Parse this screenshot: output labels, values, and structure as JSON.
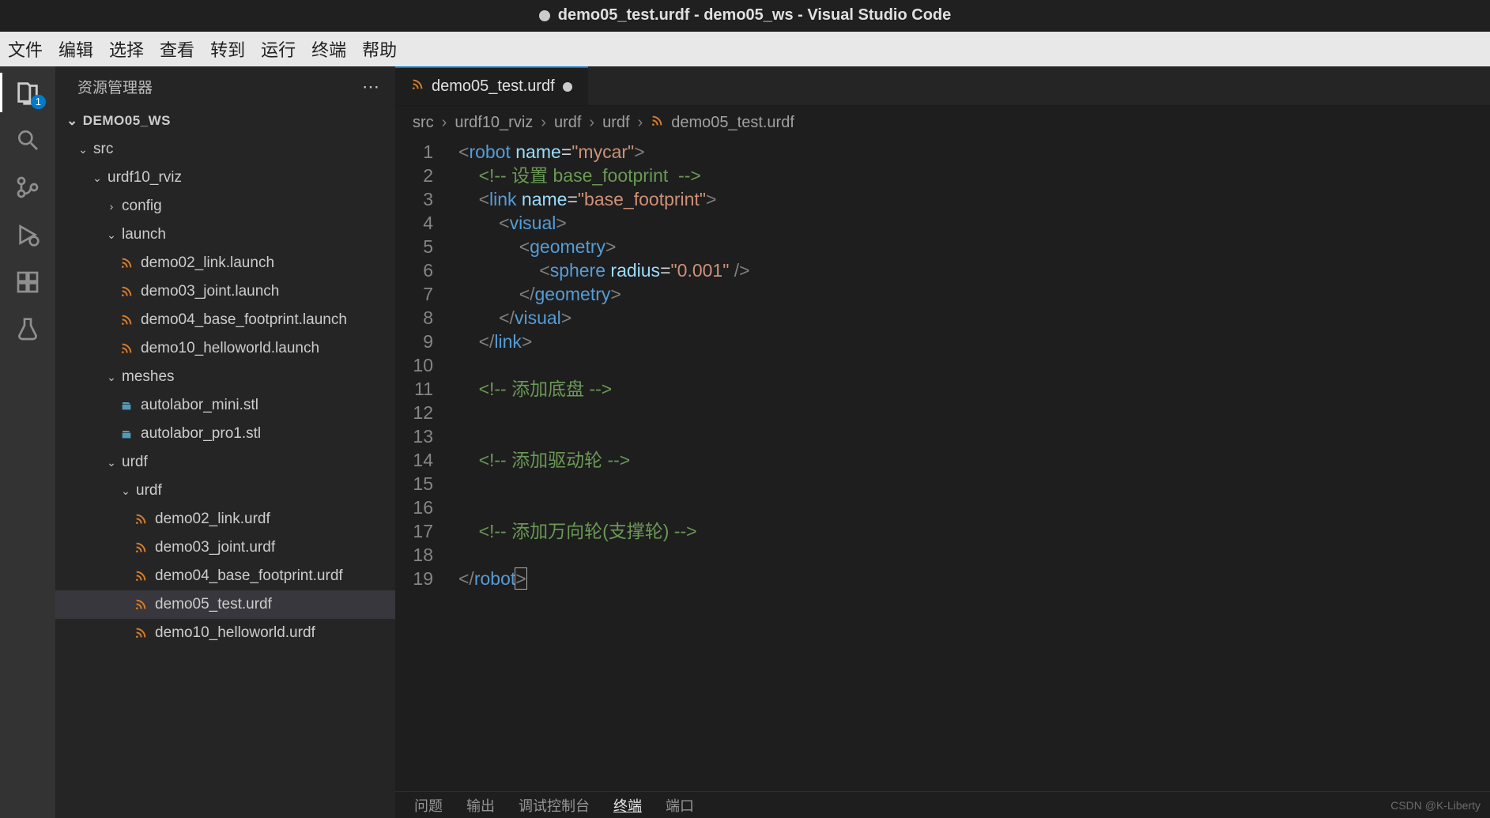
{
  "title": "demo05_test.urdf - demo05_ws - Visual Studio Code",
  "menubar": [
    "文件",
    "编辑",
    "选择",
    "查看",
    "转到",
    "运行",
    "终端",
    "帮助"
  ],
  "explorer": {
    "title": "资源管理器",
    "workspace": "DEMO05_WS",
    "badge": "1"
  },
  "tree": [
    {
      "d": 1,
      "t": "src",
      "k": "folder-open"
    },
    {
      "d": 2,
      "t": "urdf10_rviz",
      "k": "folder-open"
    },
    {
      "d": 3,
      "t": "config",
      "k": "folder-closed"
    },
    {
      "d": 3,
      "t": "launch",
      "k": "folder-open"
    },
    {
      "d": 4,
      "t": "demo02_link.launch",
      "k": "rss"
    },
    {
      "d": 4,
      "t": "demo03_joint.launch",
      "k": "rss"
    },
    {
      "d": 4,
      "t": "demo04_base_footprint.launch",
      "k": "rss"
    },
    {
      "d": 4,
      "t": "demo10_helloworld.launch",
      "k": "rss"
    },
    {
      "d": 3,
      "t": "meshes",
      "k": "folder-open"
    },
    {
      "d": 4,
      "t": "autolabor_mini.stl",
      "k": "stl"
    },
    {
      "d": 4,
      "t": "autolabor_pro1.stl",
      "k": "stl"
    },
    {
      "d": 3,
      "t": "urdf",
      "k": "folder-open"
    },
    {
      "d": 4,
      "t": "urdf",
      "k": "folder-open"
    },
    {
      "d": 5,
      "t": "demo02_link.urdf",
      "k": "rss"
    },
    {
      "d": 5,
      "t": "demo03_joint.urdf",
      "k": "rss"
    },
    {
      "d": 5,
      "t": "demo04_base_footprint.urdf",
      "k": "rss"
    },
    {
      "d": 5,
      "t": "demo05_test.urdf",
      "k": "rss",
      "sel": true
    },
    {
      "d": 5,
      "t": "demo10_helloworld.urdf",
      "k": "rss"
    }
  ],
  "tab": {
    "label": "demo05_test.urdf"
  },
  "breadcrumb": [
    "src",
    "urdf10_rviz",
    "urdf",
    "urdf",
    "demo05_test.urdf"
  ],
  "code": {
    "lines": 19,
    "content": [
      [
        {
          "c": "punc",
          "t": "<"
        },
        {
          "c": "tag",
          "t": "robot"
        },
        {
          "c": "",
          "t": " "
        },
        {
          "c": "attr",
          "t": "name"
        },
        {
          "c": "",
          "t": "="
        },
        {
          "c": "str",
          "t": "\"mycar\""
        },
        {
          "c": "punc",
          "t": ">"
        }
      ],
      [
        {
          "c": "",
          "t": "    "
        },
        {
          "c": "com",
          "t": "<!-- 设置 base_footprint  -->"
        }
      ],
      [
        {
          "c": "",
          "t": "    "
        },
        {
          "c": "punc",
          "t": "<"
        },
        {
          "c": "tag",
          "t": "link"
        },
        {
          "c": "",
          "t": " "
        },
        {
          "c": "attr",
          "t": "name"
        },
        {
          "c": "",
          "t": "="
        },
        {
          "c": "str",
          "t": "\"base_footprint\""
        },
        {
          "c": "punc",
          "t": ">"
        }
      ],
      [
        {
          "c": "",
          "t": "        "
        },
        {
          "c": "punc",
          "t": "<"
        },
        {
          "c": "tag",
          "t": "visual"
        },
        {
          "c": "punc",
          "t": ">"
        }
      ],
      [
        {
          "c": "",
          "t": "            "
        },
        {
          "c": "punc",
          "t": "<"
        },
        {
          "c": "tag",
          "t": "geometry"
        },
        {
          "c": "punc",
          "t": ">"
        }
      ],
      [
        {
          "c": "",
          "t": "                "
        },
        {
          "c": "punc",
          "t": "<"
        },
        {
          "c": "tag",
          "t": "sphere"
        },
        {
          "c": "",
          "t": " "
        },
        {
          "c": "attr",
          "t": "radius"
        },
        {
          "c": "",
          "t": "="
        },
        {
          "c": "str",
          "t": "\"0.001\""
        },
        {
          "c": "",
          "t": " "
        },
        {
          "c": "punc",
          "t": "/>"
        }
      ],
      [
        {
          "c": "",
          "t": "            "
        },
        {
          "c": "punc",
          "t": "</"
        },
        {
          "c": "tag",
          "t": "geometry"
        },
        {
          "c": "punc",
          "t": ">"
        }
      ],
      [
        {
          "c": "",
          "t": "        "
        },
        {
          "c": "punc",
          "t": "</"
        },
        {
          "c": "tag",
          "t": "visual"
        },
        {
          "c": "punc",
          "t": ">"
        }
      ],
      [
        {
          "c": "",
          "t": "    "
        },
        {
          "c": "punc",
          "t": "</"
        },
        {
          "c": "tag",
          "t": "link"
        },
        {
          "c": "punc",
          "t": ">"
        }
      ],
      [],
      [
        {
          "c": "",
          "t": "    "
        },
        {
          "c": "com",
          "t": "<!-- 添加底盘 -->"
        }
      ],
      [],
      [],
      [
        {
          "c": "",
          "t": "    "
        },
        {
          "c": "com",
          "t": "<!-- 添加驱动轮 -->"
        }
      ],
      [],
      [],
      [
        {
          "c": "",
          "t": "    "
        },
        {
          "c": "com",
          "t": "<!-- 添加万向轮(支撑轮) -->"
        }
      ],
      [],
      [
        {
          "c": "punc",
          "t": "</"
        },
        {
          "c": "tag",
          "t": "robot"
        },
        {
          "c": "punc cursor",
          "t": ">"
        }
      ]
    ]
  },
  "panel": [
    "问题",
    "输出",
    "调试控制台",
    "终端",
    "端口"
  ],
  "panel_active": 3,
  "watermark": "CSDN @K-Liberty"
}
